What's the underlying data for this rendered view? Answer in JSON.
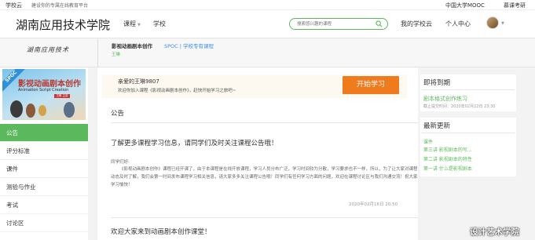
{
  "topbar": {
    "logo": "学校云",
    "slogan": "建设你的专属在线教育平台",
    "mooc": "中国大学MOOC",
    "teacher_login": "慕课考研"
  },
  "header": {
    "school_name": "湖南应用技术学院",
    "nav_course": "课程",
    "nav_school": "学校",
    "search_placeholder": "搜索感兴趣的课程",
    "my_school_cloud": "我的学校云",
    "user_center": "个人中心"
  },
  "course": {
    "institution_logo_text": "湖南应用技术",
    "title": "影视动画剧本创作",
    "type": "SPOC | 学校专有课程",
    "teacher": "王琳"
  },
  "banner": {
    "ribbon": "SPOC",
    "title": "影视动画剧本创作",
    "subtitle": "Animation Script Creation",
    "tag": "王琳 主讲"
  },
  "menu": {
    "items": [
      "公告",
      "评分标准",
      "课件",
      "测验与作业",
      "考试",
      "讨论区"
    ]
  },
  "welcome": {
    "greeting": "亲爱的王琳9807",
    "message": "欢迎你加入课程《影视动画剧本创作》，赶快开始学习之旅吧~",
    "start_button": "开始学习"
  },
  "announcements": {
    "section_title": "公告",
    "items": [
      {
        "title": "了解更多课程学习信息，请同学们及时关注课程公告哦！",
        "greeting": "同学们好:",
        "body": "《影视动画剧本创作》课程已经开课了，由于本课程是在线开放课程，学习人员分布广泛，学习时间较为分散，学习要求也不一样，所以，为了让大家对课程动态及时了解，我们会第一时间发布课程学习相关信息，请大家多多关注课程公告哦！同学们有任何学习方面的问题，欢迎在课程讨论区与我们沟通交流！祝大家学习愉快！",
        "date": "2020年02月16日 20:50"
      },
      {
        "title": "欢迎大家来到动画剧本创作课堂！"
      }
    ]
  },
  "due": {
    "title": "即将到期",
    "task": "剧本格式创作练习",
    "deadline": "截止提交时间：2020年02月22日 23:30"
  },
  "news": {
    "title": "最新更新",
    "kind": "课件",
    "items": [
      "第三讲  影视剧本的写...",
      "第二讲  影视剧本的特性",
      "第一讲  什么是影视剧本"
    ]
  },
  "watermark": "设计艺术学院",
  "colors": {
    "accent_green": "#5cb85c",
    "start_orange": "#f07b1d",
    "link_blue": "#3a8ee6"
  }
}
